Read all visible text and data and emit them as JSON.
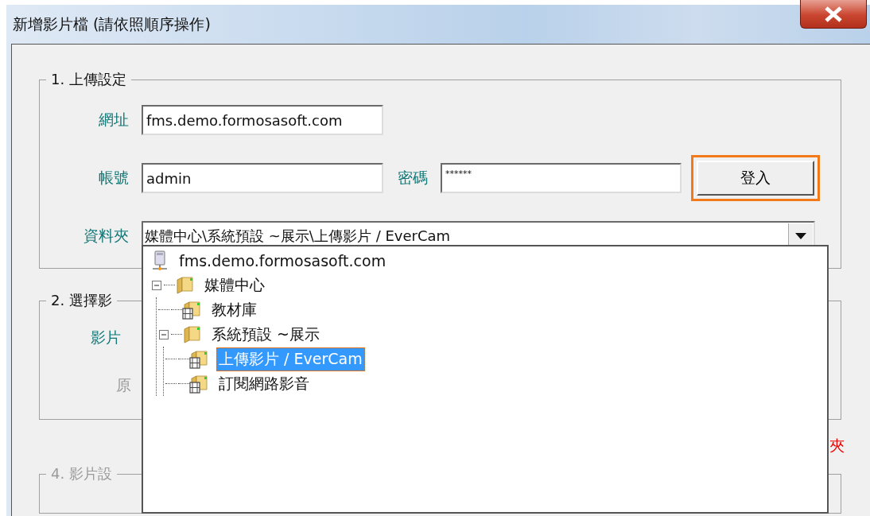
{
  "window": {
    "title": "新增影片檔 (請依照順序操作)"
  },
  "upload_settings": {
    "legend": "1. 上傳設定",
    "url_label": "網址",
    "url": "fms.demo.formosasoft.com",
    "account_label": "帳號",
    "account": "admin",
    "password_label": "密碼",
    "password": "******",
    "login_button": {
      "label": "登入",
      "highlighted": true
    },
    "folder_label": "資料夾",
    "folder": "媒體中心\\系統預設 ~展示\\上傳影片 / EverCam"
  },
  "folder_tree": [
    {
      "label": "fms.demo.formosasoft.com",
      "kind": "server",
      "selected": false,
      "children": [
        {
          "label": "媒體中心",
          "kind": "folder",
          "expanded": true,
          "selected": false,
          "children": [
            {
              "label": "教材庫",
              "kind": "film-folder",
              "selected": false
            },
            {
              "label": "系統預設 ~展示",
              "kind": "folder",
              "expanded": true,
              "selected": false,
              "children": [
                {
                  "label": "上傳影片 / EverCam",
                  "kind": "film-folder",
                  "selected": true
                },
                {
                  "label": "訂閱網路影音",
                  "kind": "film-folder",
                  "selected": false
                }
              ]
            }
          ]
        }
      ]
    }
  ],
  "select_video": {
    "legend": "2. 選擇影",
    "video_label": "影片",
    "column_text": "原"
  },
  "warning_text": "夾",
  "video_settings": {
    "legend": "4. 影片設",
    "disabled": true
  }
}
